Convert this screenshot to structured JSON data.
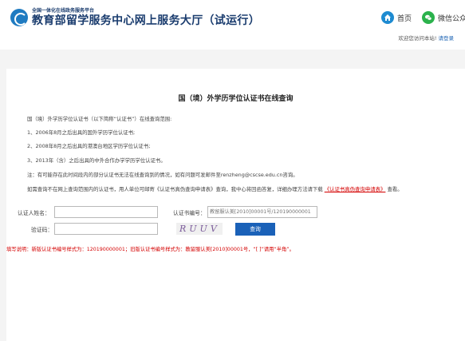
{
  "header": {
    "org_small": "全国一体化在线政务服务平台",
    "site_title": "教育部留学服务中心网上服务大厅（试运行）",
    "nav_home": "首页",
    "nav_wechat": "微信公众",
    "welcome_text": "欢迎您访问本站!",
    "login_link": "请登录"
  },
  "main": {
    "title": "国（境）外学历学位认证书在线查询",
    "intro": "国（境）外学历学位认证书（以下简称“认证书”）在线查询范围:",
    "items": [
      "1、2006年8月之后出具的国外学历学位认证书;",
      "2、2008年8月之后出具的港澳台地区学历学位认证书;",
      "3、2013年（含）之后出具的中外合作办学学历学位认证书。"
    ],
    "note": "注：有可能存在此时间段内的部分认证书无法在线查询到的情况，如有问题可发邮件至renzheng@cscse.edu.cn咨询。",
    "help_prefix": "如需查询不在网上查询范围内的认证书，用人单位可邮寄《认证书真伪查询申请表》查询，我中心将回函答复，详细办理方法请下载",
    "help_link": "《认证书真伪查询申请表》",
    "help_suffix": "查看。"
  },
  "form": {
    "name_label": "认证人姓名：",
    "name_value": "",
    "cert_label": "认证书编号：",
    "cert_placeholder": "教留服认美[2010]00001号/120190000001",
    "captcha_label": "验证码：",
    "captcha_value": "",
    "captcha_text": "RUUV",
    "query_button": "查询"
  },
  "footer_note": "填写说明：新版认证书编号样式为：120190000001；旧版认证书编号样式为：教留服认美[2010]00001号，“[ ]”请用“半角”。",
  "colors": {
    "brand_blue": "#1a61b8",
    "title_navy": "#1a3c6e",
    "warning_red": "#d40000",
    "wechat_green": "#2bb24c"
  }
}
